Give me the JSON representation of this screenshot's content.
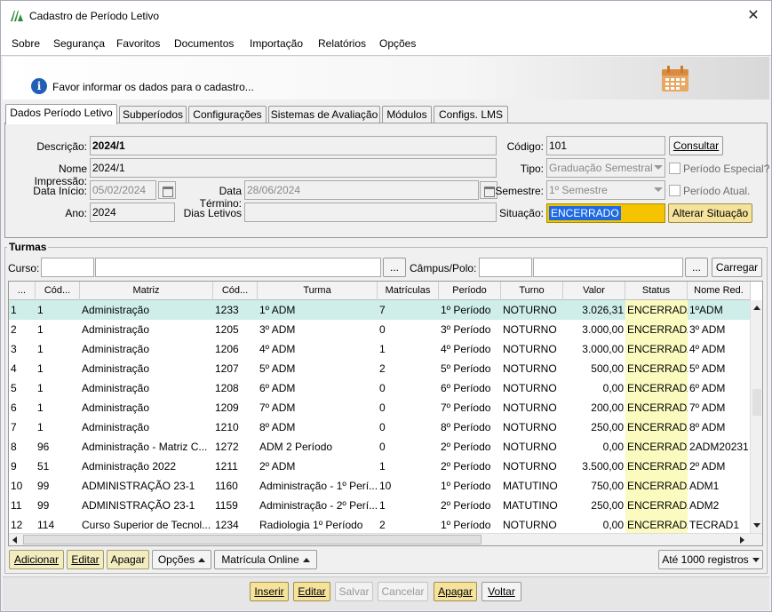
{
  "window": {
    "title": "Cadastro de Período Letivo"
  },
  "menu": {
    "items": [
      "Sobre",
      "Segurança",
      "Favoritos",
      "Documentos",
      "Importação",
      "Relatórios",
      "Opções"
    ]
  },
  "info": {
    "message": "Favor informar os dados para o cadastro..."
  },
  "tabs": [
    "Dados Período Letivo",
    "Subperíodos",
    "Configurações",
    "Sistemas de Avaliação",
    "Módulos",
    "Configs. LMS"
  ],
  "form": {
    "descricao_label": "Descrição:",
    "descricao_value": "2024/1",
    "nome_impressao_label": "Nome Impressão:",
    "nome_impressao_value": "2024/1",
    "data_inicio_label": "Data Início:",
    "data_inicio_value": "05/02/2024",
    "data_termino_label": "Data Término:",
    "data_termino_value": "28/06/2024",
    "ano_label": "Ano:",
    "ano_value": "2024",
    "dias_letivos_label": "Dias Letivos",
    "dias_letivos_value": "",
    "codigo_label": "Código:",
    "codigo_value": "101",
    "consultar_label": "Consultar",
    "tipo_label": "Tipo:",
    "tipo_value": "Graduação Semestral",
    "periodo_especial_label": "Período Especial?",
    "semestre_label": "Semestre:",
    "semestre_value": "1º Semestre",
    "periodo_atual_label": "Período Atual.",
    "situacao_label": "Situação:",
    "situacao_value": "ENCERRADO",
    "alterar_situacao_label": "Alterar Situação"
  },
  "turmas": {
    "group_title": "Turmas",
    "curso_label": "Curso:",
    "curso_code": "",
    "curso_name": "",
    "ellipsis": "...",
    "campus_label": "Câmpus/Polo:",
    "campus_code": "",
    "campus_name": "",
    "carregar_label": "Carregar",
    "columns": [
      "...",
      "Cód...",
      "Matriz",
      "Cód...",
      "Turma",
      "Matrículas",
      "Período",
      "Turno",
      "Valor",
      "Status",
      "Nome Red."
    ],
    "rows": [
      [
        "1",
        "1",
        "Administração",
        "1233",
        "1º ADM",
        "7",
        "1º Período",
        "NOTURNO",
        "3.026,31",
        "ENCERRADA",
        "1ºADM"
      ],
      [
        "2",
        "1",
        "Administração",
        "1205",
        "3º ADM",
        "0",
        "3º Período",
        "NOTURNO",
        "3.000,00",
        "ENCERRADA",
        "3º ADM"
      ],
      [
        "3",
        "1",
        "Administração",
        "1206",
        "4º ADM",
        "1",
        "4º Período",
        "NOTURNO",
        "3.000,00",
        "ENCERRADA",
        "4º ADM"
      ],
      [
        "4",
        "1",
        "Administração",
        "1207",
        "5º ADM",
        "2",
        "5º Período",
        "NOTURNO",
        "500,00",
        "ENCERRADA",
        "5º ADM"
      ],
      [
        "5",
        "1",
        "Administração",
        "1208",
        "6º ADM",
        "0",
        "6º Período",
        "NOTURNO",
        "0,00",
        "ENCERRADA",
        "6º ADM"
      ],
      [
        "6",
        "1",
        "Administração",
        "1209",
        "7º ADM",
        "0",
        "7º Período",
        "NOTURNO",
        "200,00",
        "ENCERRADA",
        "7º ADM"
      ],
      [
        "7",
        "1",
        "Administração",
        "1210",
        "8º ADM",
        "0",
        "8º Período",
        "NOTURNO",
        "250,00",
        "ENCERRADA",
        "8º ADM"
      ],
      [
        "8",
        "96",
        "Administração - Matriz C...",
        "1272",
        "ADM 2 Período",
        "0",
        "2º Período",
        "NOTURNO",
        "0,00",
        "ENCERRADA",
        "2ADM20231"
      ],
      [
        "9",
        "51",
        "Administração 2022",
        "1211",
        "2º ADM",
        "1",
        "2º Período",
        "NOTURNO",
        "3.500,00",
        "ENCERRADA",
        "2º ADM"
      ],
      [
        "10",
        "99",
        "ADMINISTRAÇÃO 23-1",
        "1160",
        "Administração - 1º Perí...",
        "10",
        "1º Período",
        "MATUTINO",
        "750,00",
        "ENCERRADA",
        "ADM1"
      ],
      [
        "11",
        "99",
        "ADMINISTRAÇÃO 23-1",
        "1159",
        "Administração - 2º Perí...",
        "1",
        "2º Período",
        "MATUTINO",
        "250,00",
        "ENCERRADA",
        "ADM2"
      ],
      [
        "12",
        "114",
        "Curso Superior de Tecnol...",
        "1234",
        "Radiologia 1º Período",
        "2",
        "1º Período",
        "NOTURNO",
        "0,00",
        "ENCERRADA",
        "TECRAD1"
      ]
    ],
    "selected_row": 0,
    "adicionar_label": "Adicionar",
    "editar_label": "Editar",
    "apagar_label": "Apagar",
    "opcoes_label": "Opções",
    "matricula_online_label": "Matrícula Online",
    "limit_label": "Até 1000 registros"
  },
  "footer": {
    "inserir": "Inserir",
    "editar": "Editar",
    "salvar": "Salvar",
    "cancelar": "Cancelar",
    "apagar": "Apagar",
    "voltar": "Voltar"
  },
  "colors": {
    "selected_row": "#cfeeea",
    "status_cell": "#fbfbc0",
    "situacao_bg": "#f5c300",
    "highlight": "#1e6ae3"
  }
}
